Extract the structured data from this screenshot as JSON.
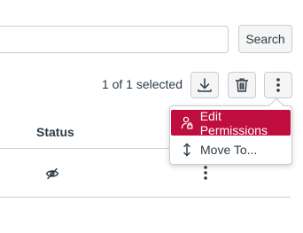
{
  "search": {
    "value": "",
    "placeholder": "",
    "button_label": "Search"
  },
  "toolbar": {
    "selection_text": "1 of 1 selected",
    "icons": [
      "download-icon",
      "trash-icon",
      "more-vertical-icon"
    ]
  },
  "table": {
    "columns": [
      "Status"
    ],
    "rows": [
      {
        "status_icon": "eye-off-icon",
        "actions_icon": "more-vertical-icon"
      }
    ]
  },
  "menu": {
    "items": [
      {
        "label": "Edit Permissions",
        "icon": "user-lock-icon",
        "active": true
      },
      {
        "label": "Move To...",
        "icon": "move-vertical-icon",
        "active": false
      }
    ]
  },
  "colors": {
    "accent": "#bf0d3e",
    "text": "#2d3b45",
    "border": "#c7cdd1",
    "button_bg": "#f5f5f5"
  }
}
